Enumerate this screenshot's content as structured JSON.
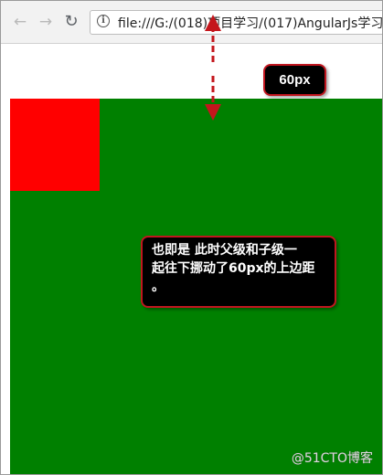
{
  "browser": {
    "back_glyph": "←",
    "forward_glyph": "→",
    "reload_glyph": "↻",
    "info_glyph": "i",
    "url": "file:///G:/(018)项目学习/(017)AngularJs学习"
  },
  "annotations": {
    "margin_label": "60px",
    "description_line1": "也即是 此时父级和子级一",
    "description_line2": "起往下挪动了60px的上边距",
    "description_line3": "。"
  },
  "colors": {
    "parent_box": "#008000",
    "child_box": "#ff0000",
    "callout_border": "#c0161f",
    "arrow": "#c4161c"
  },
  "watermark": "@51CTO博客"
}
